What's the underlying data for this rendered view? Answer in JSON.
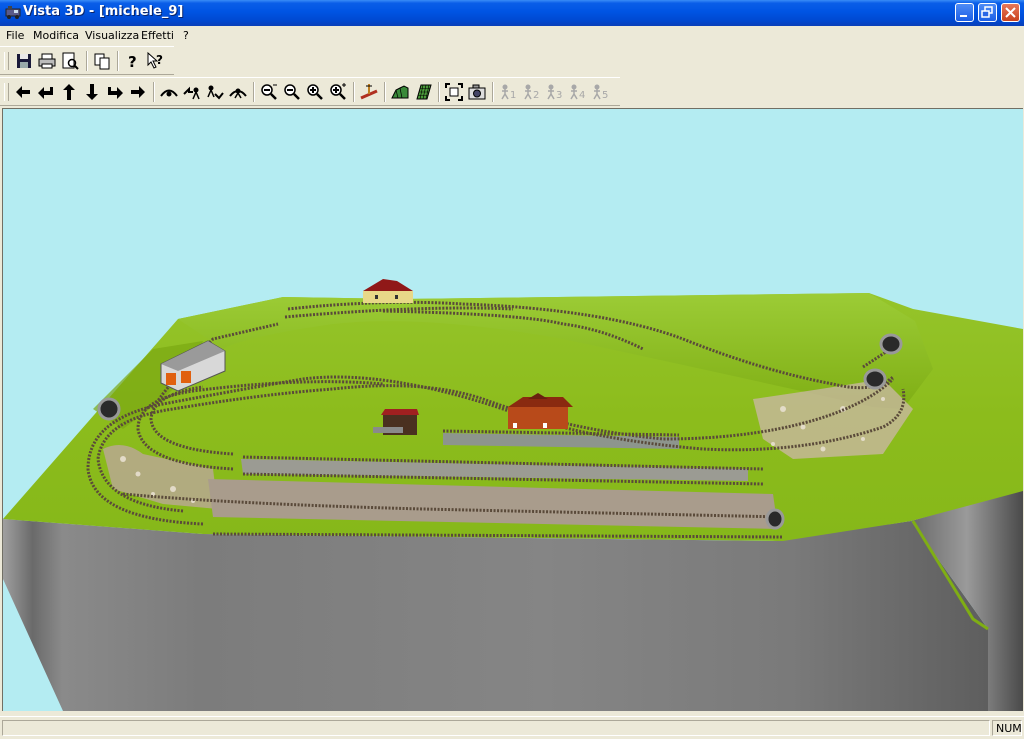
{
  "window": {
    "title": "Vista 3D - [michele_9]"
  },
  "menu": {
    "items": [
      "File",
      "Modifica",
      "Visualizza",
      "Effetti",
      "?"
    ]
  },
  "toolbar1": {
    "tools": [
      "save-icon",
      "print-icon",
      "print-preview-icon",
      "copy-icon",
      "help-icon",
      "context-help-icon"
    ]
  },
  "toolbar2": {
    "tools": [
      "arrow-left-icon",
      "arrow-back-left-icon",
      "arrow-up-icon",
      "arrow-down-icon",
      "arrow-forward-right-icon",
      "arrow-right-icon",
      "tilt-view-icon",
      "rotate-left-icon",
      "rotate-right-icon",
      "eye-level-icon",
      "zoom-out-more-icon",
      "zoom-out-icon",
      "zoom-in-icon",
      "zoom-in-more-icon",
      "track-height-icon",
      "terrain-icon",
      "grid-icon",
      "fit-view-icon",
      "snapshot-icon",
      "camera-1-icon",
      "camera-2-icon",
      "camera-3-icon",
      "camera-4-icon",
      "camera-5-icon"
    ]
  },
  "cameras": {
    "c1": "1",
    "c2": "2",
    "c3": "3",
    "c4": "4",
    "c5": "5"
  },
  "status": {
    "num": "NUM"
  },
  "colors": {
    "sky": "#b4ecf2",
    "grass": "#8fbf1e",
    "cliff": "#7a7a7a",
    "titlebar": "#0054e3"
  }
}
